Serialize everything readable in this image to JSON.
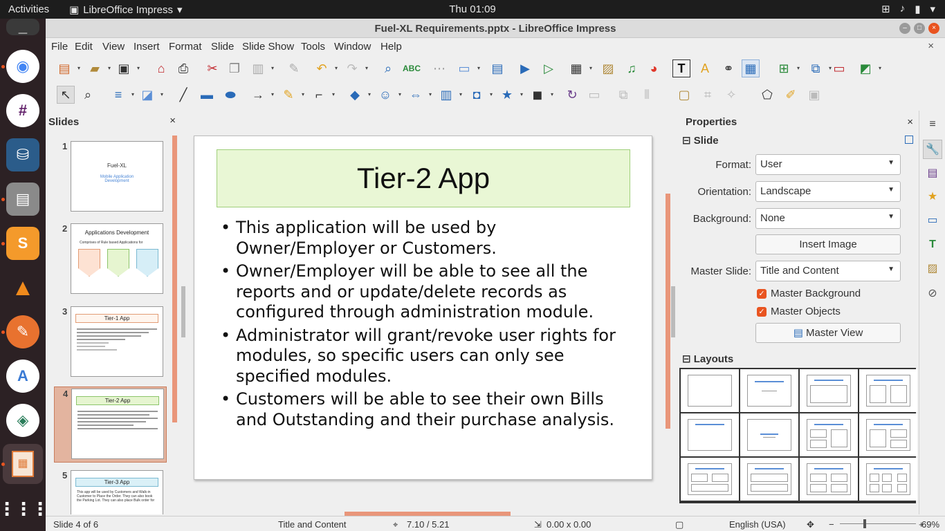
{
  "topbar": {
    "activities": "Activities",
    "app_menu": "LibreOffice Impress",
    "clock": "Thu 01:09"
  },
  "window": {
    "title": "Fuel-XL Requirements.pptx - LibreOffice Impress"
  },
  "menu": [
    "File",
    "Edit",
    "View",
    "Insert",
    "Format",
    "Slide",
    "Slide Show",
    "Tools",
    "Window",
    "Help"
  ],
  "slides_pane": {
    "title": "Slides",
    "thumbnails": [
      {
        "num": "1",
        "title": "Fuel-XL",
        "subtitle": "Mobile Application Development"
      },
      {
        "num": "2",
        "title": "Applications Development",
        "body": "Comprises of Rule based Applications for"
      },
      {
        "num": "3",
        "title": "Tier-1 App"
      },
      {
        "num": "4",
        "title": "Tier-2 App"
      },
      {
        "num": "5",
        "title": "Tier-3 App",
        "body": "This app will be used by Customers and Walk-in Customer to Place the Order. They can also book the Parking Lot. They can also place Bulk order for"
      }
    ]
  },
  "slide": {
    "title": "Tier-2 App",
    "bullets": [
      "This application will be used by Owner/Employer or Customers.",
      "Owner/Employer will be able to see all the reports and or update/delete records as configured through administration module.",
      "Administrator will grant/revoke user rights for modules, so specific users can only see specified modules.",
      "Customers will be able to see their own Bills and Outstanding and their purchase analysis."
    ]
  },
  "properties": {
    "title": "Properties",
    "slide_section": "Slide",
    "format_label": "Format:",
    "format_value": "User",
    "orientation_label": "Orientation:",
    "orientation_value": "Landscape",
    "background_label": "Background:",
    "background_value": "None",
    "insert_image": "Insert Image",
    "master_slide_label": "Master Slide:",
    "master_slide_value": "Title and Content",
    "master_background": "Master Background",
    "master_objects": "Master Objects",
    "master_view": "Master View",
    "layouts_section": "Layouts"
  },
  "statusbar": {
    "slide_pos": "Slide 4 of 6",
    "layout": "Title and Content",
    "cursor": "7.10 / 5.21",
    "size": "0.00 x 0.00",
    "language": "English (USA)",
    "zoom": "69%"
  },
  "colors": {
    "accent": "#e95420",
    "title_fill": "#e9f7d5",
    "selected_thumb": "#e3b49f"
  }
}
